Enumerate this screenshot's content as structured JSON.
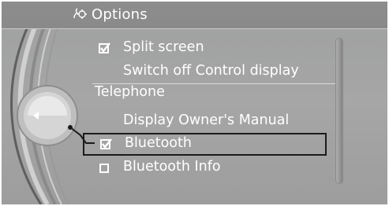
{
  "header": {
    "icon": "options-settings-icon",
    "title": "Options"
  },
  "menu": {
    "items": [
      {
        "label": "Split screen",
        "checkbox": "checked"
      },
      {
        "label": "Switch off Control display",
        "checkbox": "none"
      }
    ],
    "section_title": "Telephone",
    "section_items": [
      {
        "label": "Display Owner's Manual",
        "checkbox": "none"
      },
      {
        "label": "Bluetooth",
        "checkbox": "checked",
        "selected": true
      },
      {
        "label": "Bluetooth Info",
        "checkbox": "unchecked"
      }
    ]
  },
  "colors": {
    "screen_bg": "#a2a2a2",
    "text": "#ffffff",
    "selection_border": "#1b1b1b"
  }
}
